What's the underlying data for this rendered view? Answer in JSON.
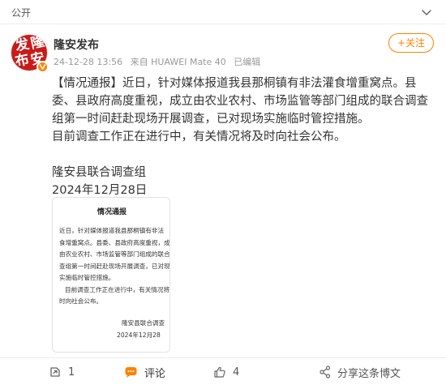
{
  "topbar": {
    "visibility": "公开",
    "menu_icon": "chevron-down-icon"
  },
  "account": {
    "avatar_chars": [
      "发",
      "隆",
      "布",
      "安"
    ],
    "name": "隆安发布",
    "time": "24-12-28 13:56",
    "source": "来自 HUAWEI Mate 40",
    "edited": "已编辑",
    "verified_badge_color": "#ff8200"
  },
  "follow_label": "+关注",
  "post": {
    "paragraphs": [
      "【情况通报】近日，针对媒体报道我县那桐镇有非法灌食增重窝点。县委、县政府高度重视，成立由农业农村、市场监管等部门组成的联合调查组第一时间赶赴现场开展调查，已对现场实施临时管控措施。",
      "目前调查工作正在进行中，有关情况将及时向社会公布。"
    ],
    "signature": "隆安县联合调查组",
    "date": "2024年12月28日"
  },
  "doc_image": {
    "title": "情况通报",
    "lines": [
      "近日，针对媒体报道我县那桐镇有非法",
      "食增重窝点。县委、县政府高度重视，成",
      "由农业农村、市场监管等部门组成的联合",
      "查组第一时间赶赴现场开展调查，已对现",
      "实施临时管控措施。",
      "目前调查工作正在进行中，有关情况将",
      "时向社会公布。"
    ],
    "sign_org": "隆安县联合调查",
    "sign_date": "2024年12月28"
  },
  "actions": {
    "repost_count": "1",
    "comment_label": "评论",
    "like_count": "4",
    "share_label": "分享这条博文"
  },
  "colors": {
    "accent": "#ff8200",
    "avatar_bg": "#c91a1a"
  }
}
